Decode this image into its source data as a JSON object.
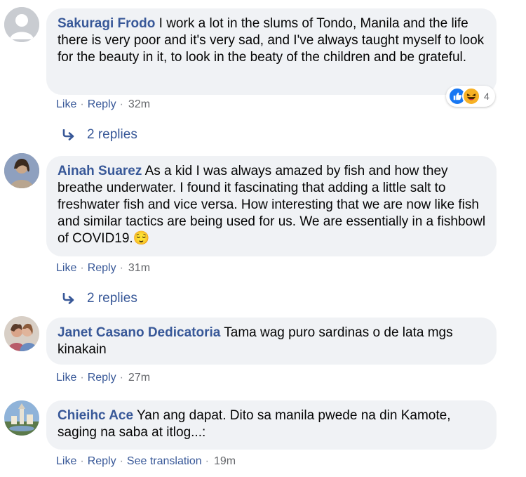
{
  "comments": [
    {
      "author": "Sakuragi Frodo",
      "text": "I work a lot in the slums of Tondo, Manila and the life there is very poor and it's very sad, and I've always taught myself to look for the beauty in it, to look in the beaty of the children and be grateful.",
      "like": "Like",
      "reply": "Reply",
      "time": "32m",
      "reaction_count": "4",
      "replies_label": "2 replies"
    },
    {
      "author": "Ainah Suarez",
      "text": "As a kid I was always amazed by fish and how they breathe underwater. I found it fascinating that adding a little salt to freshwater fish and vice versa. How interesting that we are now like fish and similar tactics are being used for us. We are essentially in a fishbowl of COVID19.",
      "emoji": "😌",
      "like": "Like",
      "reply": "Reply",
      "time": "31m",
      "replies_label": "2 replies"
    },
    {
      "author": "Janet Casano Dedicatoria",
      "text": "Tama wag puro sardinas o de lata mgs kinakain",
      "like": "Like",
      "reply": "Reply",
      "time": "27m"
    },
    {
      "author": "Chieihc Ace",
      "text": "Yan ang dapat. Dito sa manila pwede na din Kamote, saging na saba at itlog...:",
      "like": "Like",
      "reply": "Reply",
      "see_translation": "See translation",
      "time": "19m"
    }
  ],
  "icons": {
    "reply_arrow": "reply-arrow-icon",
    "like_reaction": "like-reaction-icon",
    "haha_reaction": "haha-reaction-icon"
  },
  "colors": {
    "name_link": "#385898",
    "bubble_bg": "#f0f2f5",
    "meta_text": "#65676b",
    "like_blue": "#1877f2"
  }
}
